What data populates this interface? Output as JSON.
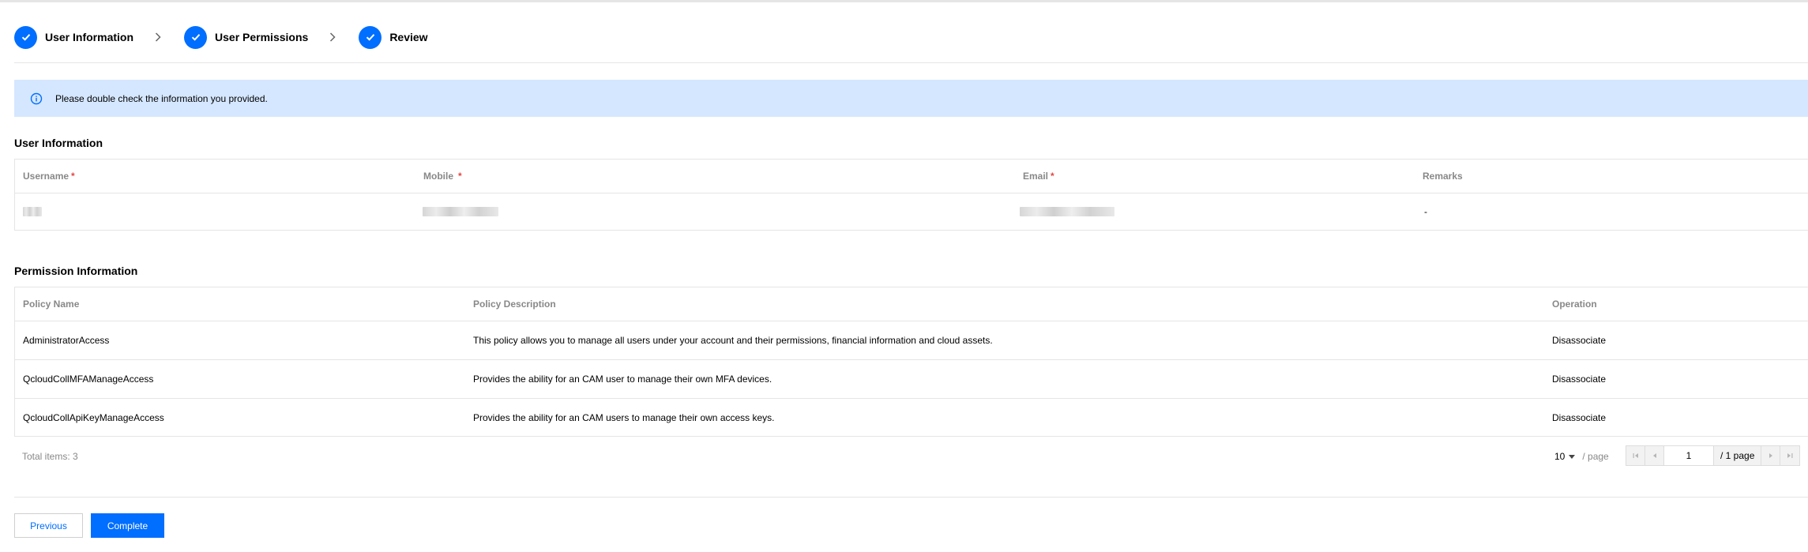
{
  "steps": [
    {
      "label": "User Information",
      "status": "completed"
    },
    {
      "label": "User Permissions",
      "status": "completed"
    },
    {
      "label": "Review",
      "status": "completed"
    }
  ],
  "alert": {
    "icon": "info-icon",
    "text": "Please double check the information you provided."
  },
  "user_info": {
    "title": "User Information",
    "columns": {
      "username": "Username",
      "mobile": "Mobile",
      "email": "Email",
      "remarks": "Remarks"
    },
    "required_mark": "*",
    "row": {
      "remarks": "-"
    }
  },
  "permission_info": {
    "title": "Permission Information",
    "columns": {
      "policy_name": "Policy Name",
      "policy_description": "Policy Description",
      "operation": "Operation"
    },
    "rows": [
      {
        "name": "AdministratorAccess",
        "description": "This policy allows you to manage all users under your account and their permissions, financial information and cloud assets.",
        "operation": "Disassociate"
      },
      {
        "name": "QcloudCollMFAManageAccess",
        "description": "Provides the ability for an CAM user to manage their own MFA devices.",
        "operation": "Disassociate"
      },
      {
        "name": "QcloudCollApiKeyManageAccess",
        "description": "Provides the ability for an CAM users to manage their own access keys.",
        "operation": "Disassociate"
      }
    ],
    "total_items": "Total items: 3",
    "page_size": "10",
    "page_size_unit": "/ page",
    "current_page": "1",
    "total_pages": "/ 1 page"
  },
  "buttons": {
    "previous": "Previous",
    "complete": "Complete"
  },
  "colors": {
    "accent": "#006eff",
    "alert_bg": "#d5e7ff",
    "required": "#e54545"
  }
}
